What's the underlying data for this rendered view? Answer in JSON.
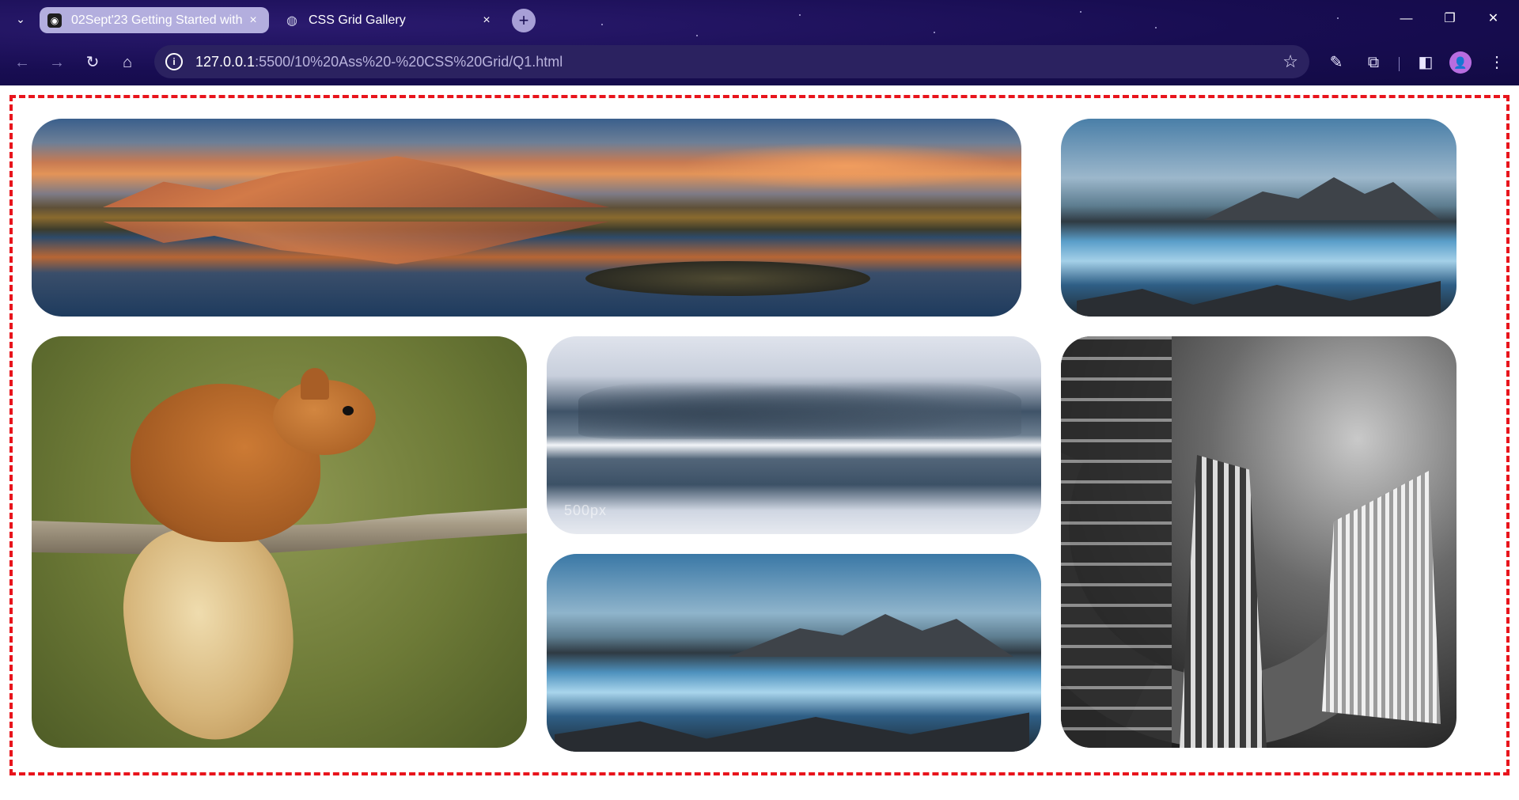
{
  "browser": {
    "tabs": [
      {
        "title": "02Sept'23 Getting Started with",
        "active": true,
        "favicon": "site-favicon"
      },
      {
        "title": "CSS Grid Gallery",
        "active": false,
        "favicon": "globe-icon"
      }
    ],
    "close_glyph": "×",
    "new_tab_glyph": "+",
    "tab_list_glyph": "⌄",
    "window_controls": {
      "minimize": "—",
      "restore": "❐",
      "close": "✕"
    },
    "nav": {
      "back": "←",
      "forward": "→",
      "reload": "↻",
      "home": "⌂"
    },
    "address": {
      "info_glyph": "i",
      "host": "127.0.0.1",
      "path": ":5500/10%20Ass%20-%20CSS%20Grid/Q1.html",
      "bookmark_glyph": "☆"
    },
    "toolbar_icons": {
      "eyedropper": "✎",
      "extensions": "⧉",
      "sidebar": "◧",
      "menu": "⋮"
    },
    "profile_initial": "👤"
  },
  "page": {
    "frame_border_color": "#e8141c",
    "gallery": [
      {
        "name": "sunset-lake-panorama",
        "description_icon": "landscape-image"
      },
      {
        "name": "coastal-mountains",
        "description_icon": "landscape-image"
      },
      {
        "name": "squirrel-on-branch",
        "description_icon": "animal-image"
      },
      {
        "name": "snowy-trees-reflection",
        "description_icon": "landscape-image",
        "watermark": "500px"
      },
      {
        "name": "coastal-mountains-2",
        "description_icon": "landscape-image"
      },
      {
        "name": "skyscrapers-bw",
        "description_icon": "architecture-image"
      }
    ]
  }
}
